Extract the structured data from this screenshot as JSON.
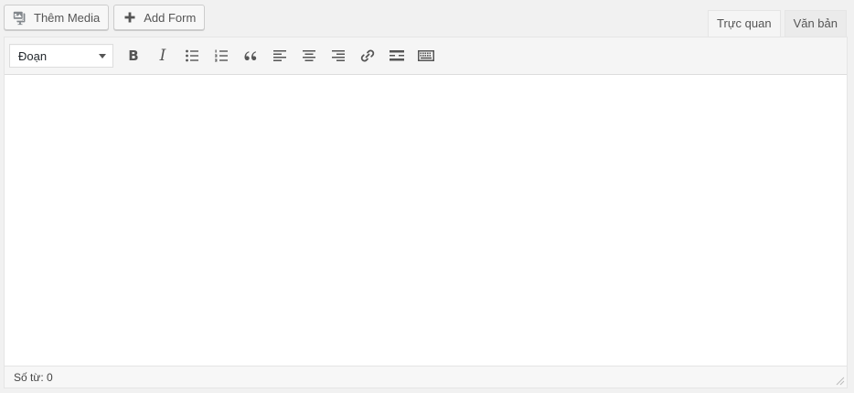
{
  "media_buttons": {
    "add_media_label": "Thêm Media",
    "add_form_label": "Add Form"
  },
  "tabs": {
    "visual_label": "Trực quan",
    "text_label": "Văn bản"
  },
  "toolbar": {
    "format_selected": "Đoạn"
  },
  "status_bar": {
    "word_count": "Số từ: 0"
  },
  "colors": {
    "icon": "#555555",
    "toolbar_bg": "#f5f5f5",
    "border": "#dddddd"
  }
}
